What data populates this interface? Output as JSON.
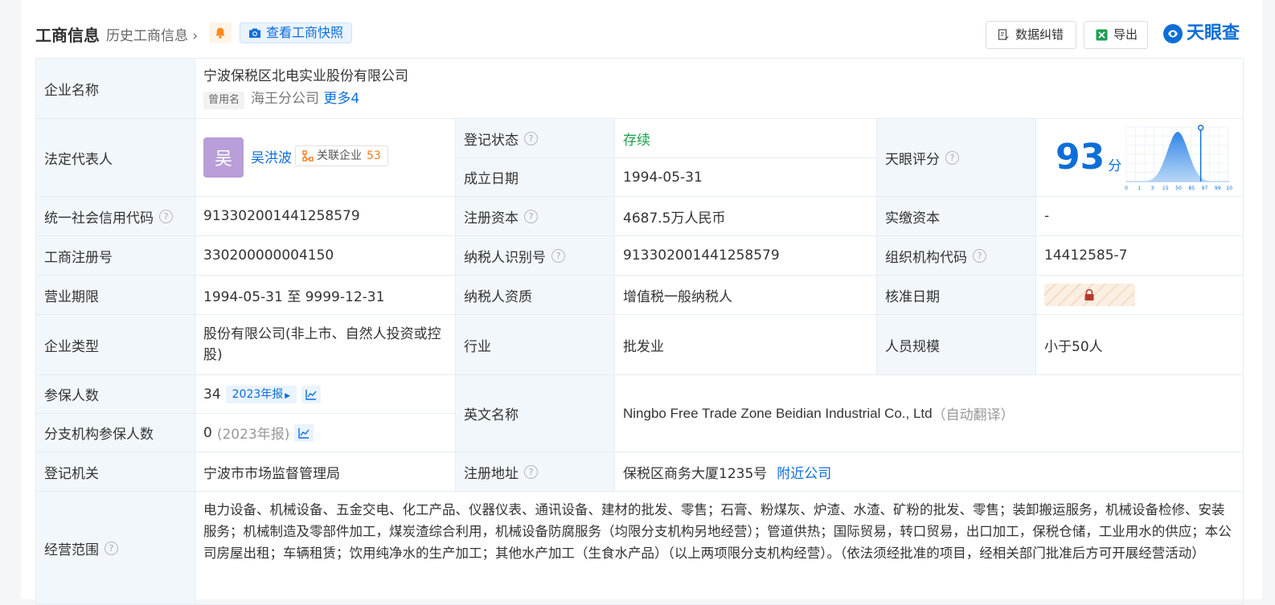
{
  "header": {
    "title": "工商信息",
    "history": "历史工商信息",
    "snapshot": "查看工商快照",
    "fix_button": "数据纠错",
    "export_button": "导出",
    "logo": "天眼查"
  },
  "company": {
    "name_label": "企业名称",
    "name": "宁波保税区北电实业股份有限公司",
    "used_name_tag": "曾用名",
    "used_name": "海王分公司",
    "more": "更多4"
  },
  "legal": {
    "label": "法定代表人",
    "avatar_char": "吴",
    "name": "吴洪波",
    "related_label": "关联企业",
    "related_count": "53"
  },
  "status": {
    "label": "登记状态",
    "value": "存续"
  },
  "founded": {
    "label": "成立日期",
    "value": "1994-05-31"
  },
  "score": {
    "label": "天眼评分",
    "value": "93",
    "unit": "分",
    "x_ticks": [
      "0",
      "1",
      "3",
      "15",
      "50",
      "85",
      "97",
      "99",
      "100"
    ],
    "marker": 93
  },
  "credit_code": {
    "label": "统一社会信用代码",
    "value": "91330200144125857​9"
  },
  "capital": {
    "label": "注册资本",
    "value": "4687.5万人民币"
  },
  "paid_capital": {
    "label": "实缴资本",
    "value": "-"
  },
  "reg_no": {
    "label": "工商注册号",
    "value": "330200000004150"
  },
  "taxpayer_id": {
    "label": "纳税人识别号",
    "value": "913302001441258579"
  },
  "org_code": {
    "label": "组织机构代码",
    "value": "14412585-7"
  },
  "term": {
    "label": "营业期限",
    "value": "1994-05-31 至 9999-12-31"
  },
  "taxpayer_type": {
    "label": "纳税人资质",
    "value": "增值税一般纳税人"
  },
  "approval": {
    "label": "核准日期"
  },
  "company_type": {
    "label": "企业类型",
    "value": "股份有限公司(非上市、自然人投资或控股)"
  },
  "industry": {
    "label": "行业",
    "value": "批发业"
  },
  "staff": {
    "label": "人员规模",
    "value": "小于50人"
  },
  "insured": {
    "label": "参保人数",
    "value": "34",
    "report": "2023年报"
  },
  "branch_insured": {
    "label": "分支机构参保人数",
    "value": "0",
    "report": "(2023年报)"
  },
  "english": {
    "label": "英文名称",
    "value": "Ningbo Free Trade Zone Beidian Industrial Co., Ltd",
    "note": "（自动翻译）"
  },
  "authority": {
    "label": "登记机关",
    "value": "宁波市市场监督管理局"
  },
  "address": {
    "label": "注册地址",
    "value": "保税区商务大厦1235号",
    "nearby": "附近公司"
  },
  "scope": {
    "label": "经营范围",
    "value": "电力设备、机械设备、五金交电、化工产品、仪器仪表、通讯设备、建材的批发、零售；石膏、粉煤灰、炉渣、水渣、矿粉的批发、零售；装卸搬运服务，机械设备检修、安装服务；机械制造及零部件加工，煤炭渣综合利用，机械设备防腐服务（均限分支机构另地经营）；管道供热；国际贸易，转口贸易，出口加工，保税仓储，工业用水的供应；本公司房屋出租；车辆租赁；饮用纯净水的生产加工；其他水产加工（生食水产品）（以上两项限分支机构经营）。（依法须经批准的项目，经相关部门批准后方可开展经营活动）"
  },
  "colors": {
    "accent": "#0d6ed8",
    "label_bg": "#f2f7fc",
    "status_green": "#18a04a",
    "count_orange": "#ff7a1b"
  }
}
